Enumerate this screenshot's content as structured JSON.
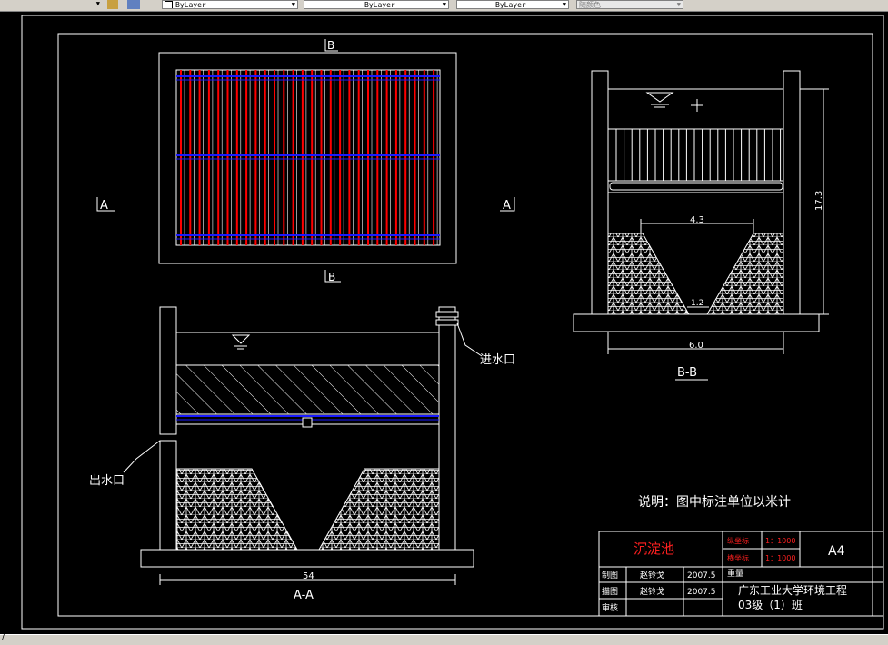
{
  "toolbar": {
    "linetype_label": "ByLayer",
    "lineweight_label": "ByLayer",
    "plotstyle_label": "ByLayer",
    "color_label": "随颜色"
  },
  "drawing": {
    "plan_section_mark_top": "B",
    "plan_section_mark_bottom": "B",
    "plan_section_mark_left": "A",
    "plan_section_mark_right": "A",
    "section_aa_title": "A-A",
    "section_bb_title": "B-B",
    "inlet_label": "进水口",
    "outlet_label": "出水口",
    "dim_aa_width": "54",
    "dim_bb_width": "6.0",
    "dim_bb_height": "17.3",
    "dim_bb_top": "4.3",
    "dim_bb_bottom": "1.2",
    "note": "说明：图中标注单位以米计"
  },
  "title_block": {
    "drawing_name": "沉淀池",
    "vertical_scale_label": "纵坐标",
    "vertical_scale_value": "1：1000",
    "horizontal_scale_label": "横坐标",
    "horizontal_scale_value": "1：1000",
    "sheet_size": "A4",
    "row1_role": "制图",
    "row1_name": "赵铃戈",
    "row1_date": "2007.5",
    "row2_role": "描图",
    "row2_name": "赵铃戈",
    "row2_date": "2007.5",
    "row3_role": "审核",
    "weight_label": "重量",
    "school_line1": "广东工业大学环境工程",
    "school_line2": "03级（1）班"
  },
  "colors": {
    "background": "#000000",
    "line": "#ffffff",
    "pipe_red": "#ff0000",
    "pipe_blue": "#1a1aff",
    "title_red": "#ff2020"
  }
}
